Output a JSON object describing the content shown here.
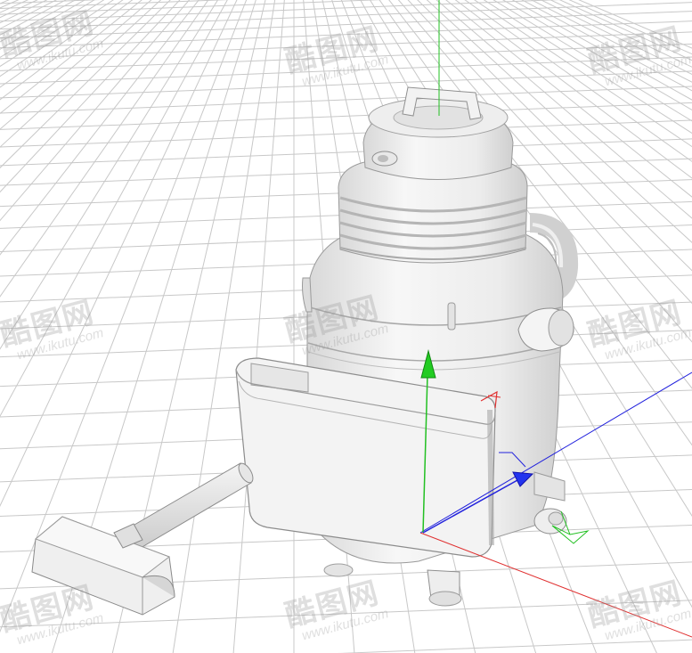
{
  "viewport": {
    "background": "#ffffff",
    "grid_color": "#c8c8c8",
    "model_color": "#f2f2f2",
    "shade_color": "#d9d9d9"
  },
  "axes": {
    "x_color": "#e03030",
    "y_color": "#22c022",
    "z_color": "#2222dd"
  },
  "watermark": {
    "logo": "酷图网",
    "url": "www.ikutu.com",
    "color": "#969696"
  }
}
